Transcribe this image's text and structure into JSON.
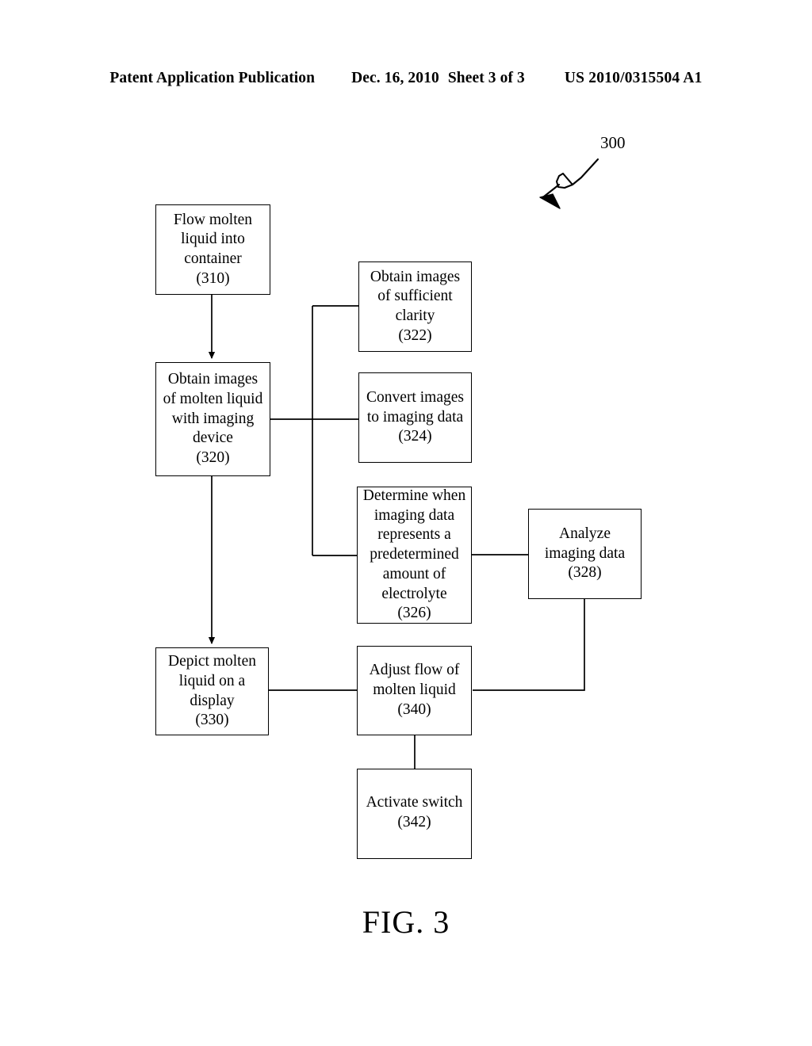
{
  "header": {
    "publication": "Patent Application Publication",
    "date": "Dec. 16, 2010",
    "sheet": "Sheet 3 of 3",
    "patent_number": "US 2010/0315504 A1"
  },
  "figure": {
    "caption": "FIG. 3",
    "reference_numeral": "300",
    "lead_line": "squiggle-arrow pointing down-left from numeral 300"
  },
  "flowchart": {
    "boxes": [
      {
        "id": "310",
        "lines": [
          "Flow molten",
          "liquid into",
          "container"
        ],
        "ref": "(310)"
      },
      {
        "id": "320",
        "lines": [
          "Obtain images",
          "of molten liquid",
          "with imaging",
          "device"
        ],
        "ref": "(320)"
      },
      {
        "id": "322",
        "lines": [
          "Obtain images",
          "of sufficient",
          "clarity"
        ],
        "ref": "(322)"
      },
      {
        "id": "324",
        "lines": [
          "Convert images",
          "to imaging data"
        ],
        "ref": "(324)"
      },
      {
        "id": "326",
        "lines": [
          "Determine when",
          "imaging data",
          "represents a",
          "predetermined",
          "amount of",
          "electrolyte"
        ],
        "ref": "(326)"
      },
      {
        "id": "328",
        "lines": [
          "Analyze",
          "imaging data"
        ],
        "ref": "(328)"
      },
      {
        "id": "330",
        "lines": [
          "Depict molten",
          "liquid on a",
          "display"
        ],
        "ref": "(330)"
      },
      {
        "id": "340",
        "lines": [
          "Adjust flow of",
          "molten liquid"
        ],
        "ref": "(340)"
      },
      {
        "id": "342",
        "lines": [
          "Activate switch"
        ],
        "ref": "(342)"
      }
    ],
    "connectors": [
      {
        "from": "310",
        "to": "320",
        "style": "arrow-down"
      },
      {
        "from": "320",
        "to": "330",
        "style": "arrow-down"
      },
      {
        "from": "320",
        "to": "322",
        "style": "line-branch"
      },
      {
        "from": "320",
        "to": "324",
        "style": "line-branch"
      },
      {
        "from": "320",
        "to": "326",
        "style": "line-branch"
      },
      {
        "from": "326",
        "to": "328",
        "style": "line"
      },
      {
        "from": "328",
        "to": "340",
        "style": "line-elbow"
      },
      {
        "from": "330",
        "to": "340",
        "style": "line"
      },
      {
        "from": "340",
        "to": "342",
        "style": "line"
      }
    ]
  }
}
